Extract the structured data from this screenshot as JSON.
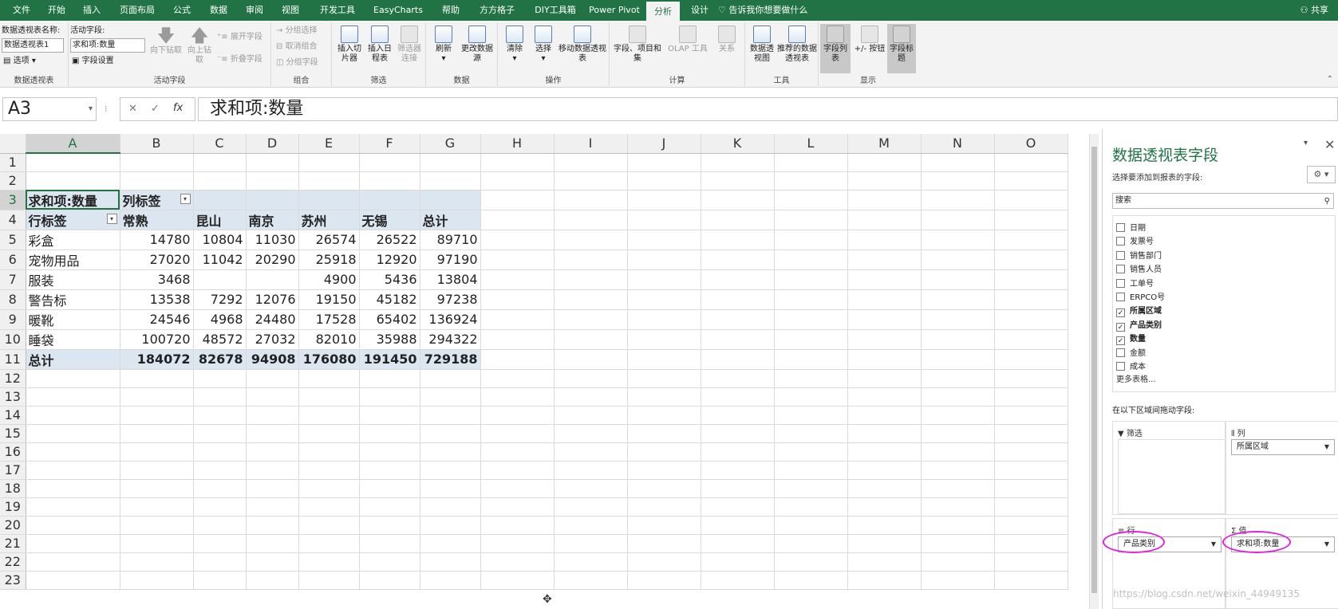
{
  "tabs": [
    "文件",
    "开始",
    "插入",
    "页面布局",
    "公式",
    "数据",
    "审阅",
    "视图",
    "开发工具",
    "EasyCharts",
    "帮助",
    "方方格子",
    "DIY工具箱",
    "Power Pivot",
    "分析",
    "设计"
  ],
  "active_tab": "分析",
  "tell_me": "告诉我你想要做什么",
  "share": "共享",
  "ribbon": {
    "pivot_name_label": "数据透视表名称:",
    "pivot_name_value": "数据透视表1",
    "options_label": "选项",
    "grp_pivot": "数据透视表",
    "active_field_label": "活动字段:",
    "active_field_value": "求和项:数量",
    "field_settings": "字段设置",
    "drill_down": "向下钻取",
    "drill_up": "向上钻取",
    "expand_field": "展开字段",
    "collapse_field": "折叠字段",
    "grp_active_field": "活动字段",
    "group_selection": "分组选择",
    "ungroup": "取消组合",
    "group_field": "分组字段",
    "grp_group": "组合",
    "insert_slicer": "插入切片器",
    "insert_timeline": "插入日程表",
    "filter_connections": "筛选器连接",
    "grp_filter": "筛选",
    "refresh": "刷新",
    "change_source": "更改数据源",
    "grp_data": "数据",
    "clear": "清除",
    "select": "选择",
    "move_pivot": "移动数据透视表",
    "grp_actions": "操作",
    "fields_items": "字段、项目和集",
    "olap_tools": "OLAP 工具",
    "relationships": "关系",
    "grp_calc": "计算",
    "pivot_chart": "数据透视图",
    "recommended": "推荐的数据透视表",
    "grp_tools": "工具",
    "field_list": "字段列表",
    "plus_minus": "+/- 按钮",
    "field_headers": "字段标题",
    "grp_show": "显示"
  },
  "formula_bar": {
    "name_box": "A3",
    "formula": "求和项:数量"
  },
  "sheet": {
    "columns": [
      "A",
      "B",
      "C",
      "D",
      "E",
      "F",
      "G",
      "H",
      "I",
      "J",
      "K",
      "L",
      "M",
      "N",
      "O"
    ],
    "rows": [
      "1",
      "2",
      "3",
      "4",
      "5",
      "6",
      "7",
      "8",
      "9",
      "10",
      "11",
      "12",
      "13",
      "14",
      "15",
      "16",
      "17",
      "18",
      "19",
      "20",
      "21",
      "22",
      "23"
    ],
    "pivot": {
      "corner": "求和项:数量",
      "col_label": "列标签",
      "row_label": "行标签",
      "headers": [
        "常熟",
        "昆山",
        "南京",
        "苏州",
        "无锡",
        "总计"
      ],
      "data": [
        [
          "彩盒",
          "14780",
          "10804",
          "11030",
          "26574",
          "26522",
          "89710"
        ],
        [
          "宠物用品",
          "27020",
          "11042",
          "20290",
          "25918",
          "12920",
          "97190"
        ],
        [
          "服装",
          "3468",
          "",
          "",
          "4900",
          "5436",
          "13804"
        ],
        [
          "警告标",
          "13538",
          "7292",
          "12076",
          "19150",
          "45182",
          "97238"
        ],
        [
          "暖靴",
          "24546",
          "4968",
          "24480",
          "17528",
          "65402",
          "136924"
        ],
        [
          "睡袋",
          "100720",
          "48572",
          "27032",
          "82010",
          "35988",
          "294322"
        ]
      ],
      "total": [
        "总计",
        "184072",
        "82678",
        "94908",
        "176080",
        "191450",
        "729188"
      ]
    }
  },
  "pane": {
    "title": "数据透视表字段",
    "subtitle": "选择要添加到报表的字段:",
    "search": "搜索",
    "fields": [
      {
        "name": "日期",
        "checked": false
      },
      {
        "name": "发票号",
        "checked": false
      },
      {
        "name": "销售部门",
        "checked": false
      },
      {
        "name": "销售人员",
        "checked": false
      },
      {
        "name": "工单号",
        "checked": false
      },
      {
        "name": "ERPCO号",
        "checked": false
      },
      {
        "name": "所属区域",
        "checked": true
      },
      {
        "name": "产品类别",
        "checked": true
      },
      {
        "name": "数量",
        "checked": true
      },
      {
        "name": "金额",
        "checked": false
      },
      {
        "name": "成本",
        "checked": false
      }
    ],
    "more_tables": "更多表格...",
    "drag_text": "在以下区域间拖动字段:",
    "area_filter": "筛选",
    "area_columns": "列",
    "area_rows": "行",
    "area_values": "值",
    "columns_chip": "所属区域",
    "rows_chip": "产品类别",
    "values_chip": "求和项:数量"
  },
  "watermark": "https://blog.csdn.net/weixin_44949135",
  "colors": {
    "accent": "#217346",
    "pivot_fill": "#dce6f1",
    "highlight": "#e020e0"
  }
}
